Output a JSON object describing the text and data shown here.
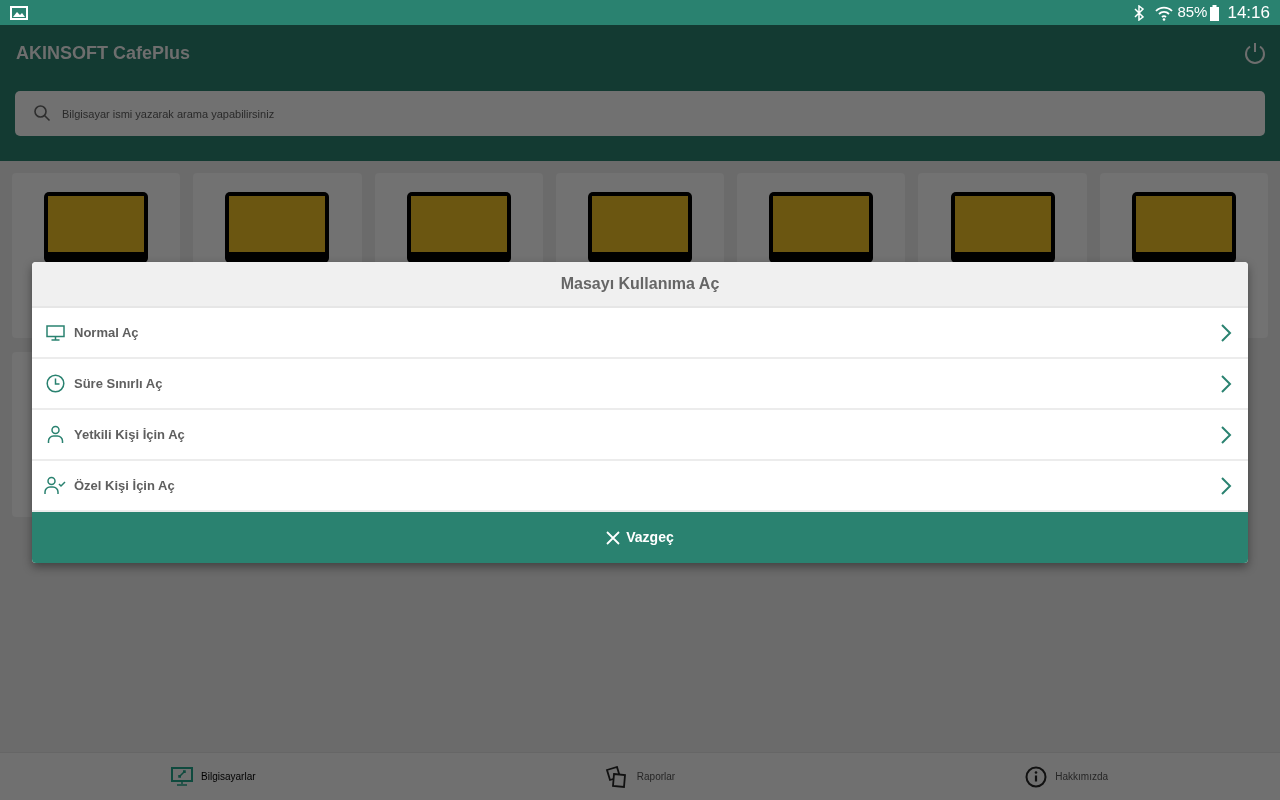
{
  "status_bar": {
    "battery": "85%",
    "time": "14:16"
  },
  "app_bar": {
    "title": "AKINSOFT CafePlus"
  },
  "search": {
    "placeholder": "Bilgisayar ismi yazarak arama yapabilirsiniz"
  },
  "computers": [
    {
      "kind": "monitor"
    },
    {
      "kind": "monitor"
    },
    {
      "kind": "monitor"
    },
    {
      "kind": "monitor"
    },
    {
      "kind": "monitor"
    },
    {
      "kind": "monitor"
    },
    {
      "kind": "monitor"
    },
    {
      "kind": "blank"
    }
  ],
  "dialog": {
    "title": "Masayı Kullanıma Aç",
    "options": [
      {
        "label": "Normal Aç"
      },
      {
        "label": "Süre Sınırlı Aç"
      },
      {
        "label": "Yetkili Kişi İçin Aç"
      },
      {
        "label": "Özel Kişi İçin Aç"
      }
    ],
    "cancel": "Vazgeç"
  },
  "bottom_nav": [
    {
      "label": "Bilgisayarlar",
      "selected": true
    },
    {
      "label": "Raporlar",
      "selected": false
    },
    {
      "label": "Hakkımızda",
      "selected": false
    }
  ]
}
